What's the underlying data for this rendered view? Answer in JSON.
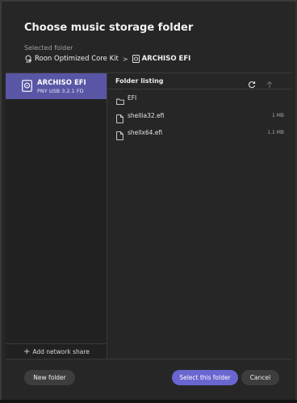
{
  "dialog": {
    "title": "Choose music storage folder",
    "selected_label": "Selected folder",
    "breadcrumb": {
      "root": "Roon Optimized Core Kit",
      "root_icon": "core-kit-icon",
      "separator": ">",
      "current": "ARCHISO EFI",
      "current_icon": "usb-drive-icon"
    }
  },
  "sidebar": {
    "drives": [
      {
        "name": "ARCHISO EFI",
        "subtitle": "PNY USB 3.2.1 FD",
        "icon": "usb-drive-icon",
        "selected": true
      }
    ],
    "add_network_share": "Add network share"
  },
  "listing": {
    "header": "Folder listing",
    "items": [
      {
        "type": "folder",
        "name": "EFI",
        "size": ""
      },
      {
        "type": "file",
        "name": "shellia32.efi",
        "size": "1 MB"
      },
      {
        "type": "file",
        "name": "shellx64.efi",
        "size": "1.1 MB"
      }
    ]
  },
  "buttons": {
    "new_folder": "New folder",
    "select_folder": "Select this folder",
    "cancel": "Cancel"
  },
  "colors": {
    "accent": "#6a66d0",
    "selected_item": "#5956a6",
    "background": "#262626"
  }
}
